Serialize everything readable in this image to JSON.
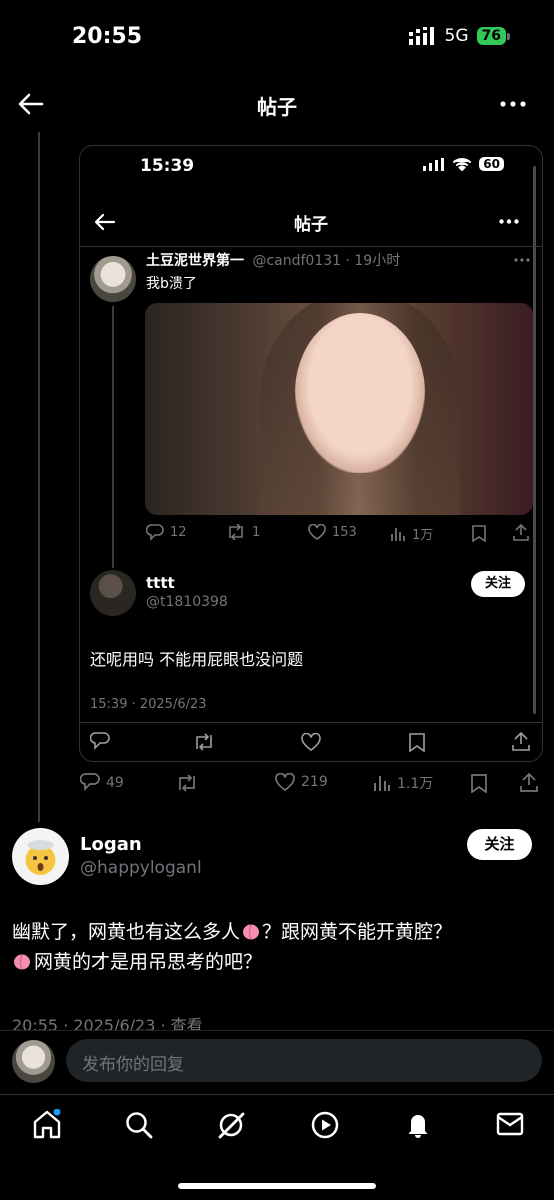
{
  "status_bar": {
    "time": "20:55",
    "network": "5G",
    "battery": "76"
  },
  "header": {
    "title": "帖子"
  },
  "embedded": {
    "status_time": "15:39",
    "battery": "60",
    "title": "帖子",
    "post": {
      "author": "土豆泥世界第一",
      "meta": "@candf0131 · 19小时",
      "text": "我b溃了",
      "actions": {
        "replies": "12",
        "reposts": "1",
        "likes": "153",
        "views": "1万"
      }
    },
    "reply": {
      "author": "tttt",
      "handle": "@t1810398",
      "follow_label": "关注",
      "text": "还呢用吗 不能用屁眼也没问题",
      "timestamp": "15:39 · 2025/6/23"
    }
  },
  "quote_actions": {
    "replies": "49",
    "likes": "219",
    "views": "1.1万"
  },
  "main_post": {
    "author": "Logan",
    "handle": "@happyloganl",
    "follow_label": "关注",
    "text_line1": "幽默了，网黄也有这么多人",
    "text_line1b": "？跟网黄不能开黄腔？",
    "text_line2": "网黄的才是用吊思考的吧？",
    "timestamp": "20:55 · 2025/6/23 · 查看"
  },
  "reply_bar": {
    "placeholder": "发布你的回复"
  },
  "colors": {
    "background": "#000000",
    "text": "#e7e9ea",
    "muted": "#71767b",
    "accent": "#1d9bf0",
    "battery_green": "#34c759"
  }
}
